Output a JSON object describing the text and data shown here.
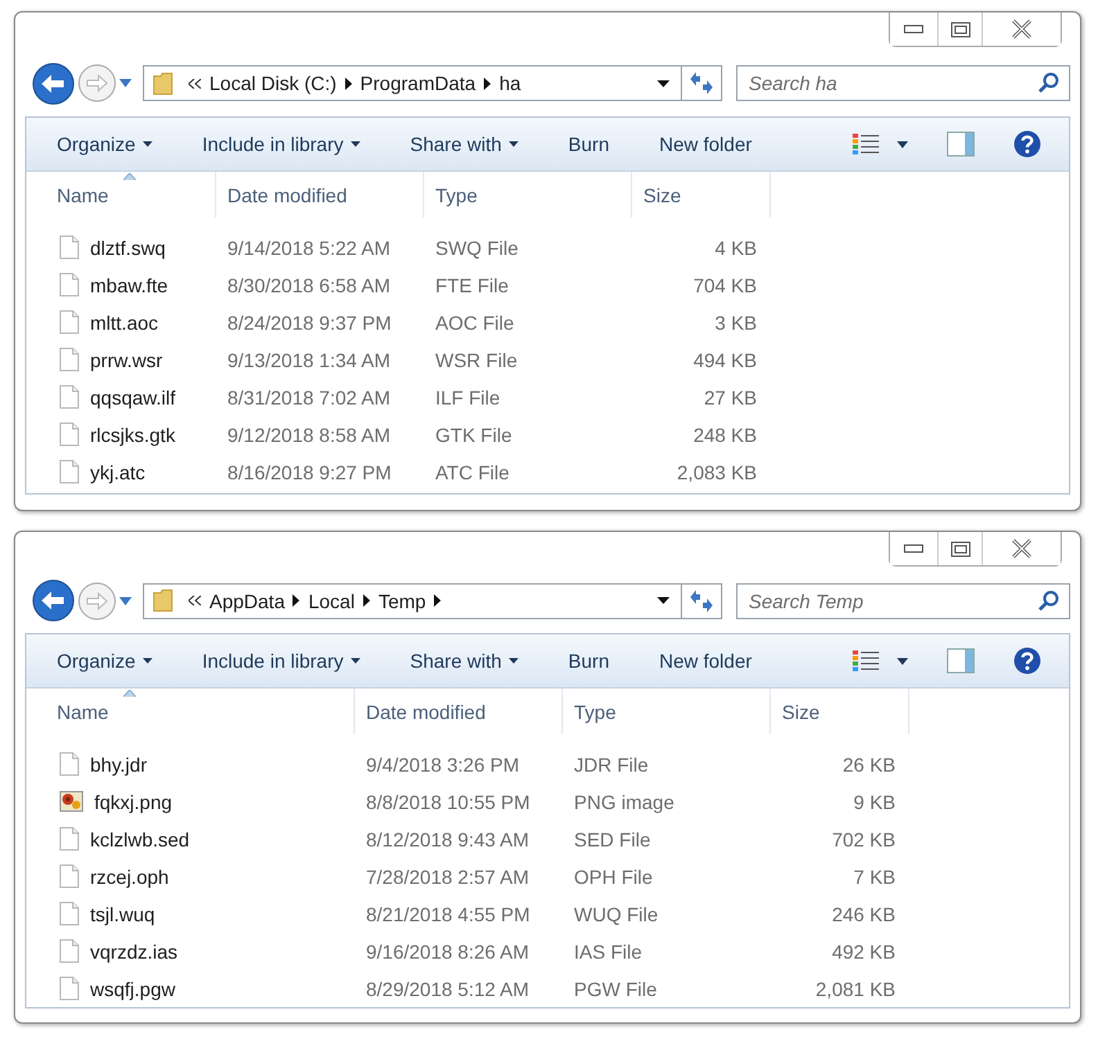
{
  "windows": [
    {
      "breadcrumb": [
        "Local Disk (C:)",
        "ProgramData",
        "ha"
      ],
      "trailing_arrow": false,
      "search": {
        "placeholder": "Search ha"
      },
      "toolbar": [
        {
          "label": "Organize",
          "kind": "menu"
        },
        {
          "label": "Include in library",
          "kind": "menu"
        },
        {
          "label": "Share with",
          "kind": "menu"
        },
        {
          "label": "Burn",
          "kind": "button"
        },
        {
          "label": "New folder",
          "kind": "button"
        }
      ],
      "columns": [
        {
          "label": "Name",
          "sorted": true
        },
        {
          "label": "Date modified",
          "sorted": false
        },
        {
          "label": "Type",
          "sorted": false
        },
        {
          "label": "Size",
          "sorted": false
        }
      ],
      "rows": [
        {
          "name": "dlztf.swq",
          "date": "9/14/2018 5:22 AM",
          "type": "SWQ File",
          "size": "4 KB",
          "kind": "document"
        },
        {
          "name": "mbaw.fte",
          "date": "8/30/2018 6:58 AM",
          "type": "FTE File",
          "size": "704 KB",
          "kind": "document"
        },
        {
          "name": "mltt.aoc",
          "date": "8/24/2018 9:37 PM",
          "type": "AOC File",
          "size": "3 KB",
          "kind": "document"
        },
        {
          "name": "prrw.wsr",
          "date": "9/13/2018 1:34 AM",
          "type": "WSR File",
          "size": "494 KB",
          "kind": "document"
        },
        {
          "name": "qqsqaw.ilf",
          "date": "8/31/2018 7:02 AM",
          "type": "ILF File",
          "size": "27 KB",
          "kind": "document"
        },
        {
          "name": "rlcsjks.gtk",
          "date": "9/12/2018 8:58 AM",
          "type": "GTK File",
          "size": "248 KB",
          "kind": "document"
        },
        {
          "name": "ykj.atc",
          "date": "8/16/2018 9:27 PM",
          "type": "ATC File",
          "size": "2,083 KB",
          "kind": "document"
        }
      ]
    },
    {
      "breadcrumb": [
        "AppData",
        "Local",
        "Temp"
      ],
      "trailing_arrow": true,
      "search": {
        "placeholder": "Search Temp"
      },
      "toolbar": [
        {
          "label": "Organize",
          "kind": "menu"
        },
        {
          "label": "Include in library",
          "kind": "menu"
        },
        {
          "label": "Share with",
          "kind": "menu"
        },
        {
          "label": "Burn",
          "kind": "button"
        },
        {
          "label": "New folder",
          "kind": "button"
        }
      ],
      "columns": [
        {
          "label": "Name",
          "sorted": true
        },
        {
          "label": "Date modified",
          "sorted": false
        },
        {
          "label": "Type",
          "sorted": false
        },
        {
          "label": "Size",
          "sorted": false
        }
      ],
      "rows": [
        {
          "name": "bhy.jdr",
          "date": "9/4/2018 3:26 PM",
          "type": "JDR File",
          "size": "26 KB",
          "kind": "document"
        },
        {
          "name": "fqkxj.png",
          "date": "8/8/2018 10:55 PM",
          "type": "PNG image",
          "size": "9 KB",
          "kind": "image"
        },
        {
          "name": "kclzlwb.sed",
          "date": "8/12/2018 9:43 AM",
          "type": "SED File",
          "size": "702 KB",
          "kind": "document"
        },
        {
          "name": "rzcej.oph",
          "date": "7/28/2018 2:57 AM",
          "type": "OPH File",
          "size": "7 KB",
          "kind": "document"
        },
        {
          "name": "tsjl.wuq",
          "date": "8/21/2018 4:55 PM",
          "type": "WUQ File",
          "size": "246 KB",
          "kind": "document"
        },
        {
          "name": "vqrzdz.ias",
          "date": "9/16/2018 8:26 AM",
          "type": "IAS File",
          "size": "492 KB",
          "kind": "document"
        },
        {
          "name": "wsqfj.pgw",
          "date": "8/29/2018 5:12 AM",
          "type": "PGW File",
          "size": "2,081 KB",
          "kind": "document"
        }
      ]
    }
  ]
}
